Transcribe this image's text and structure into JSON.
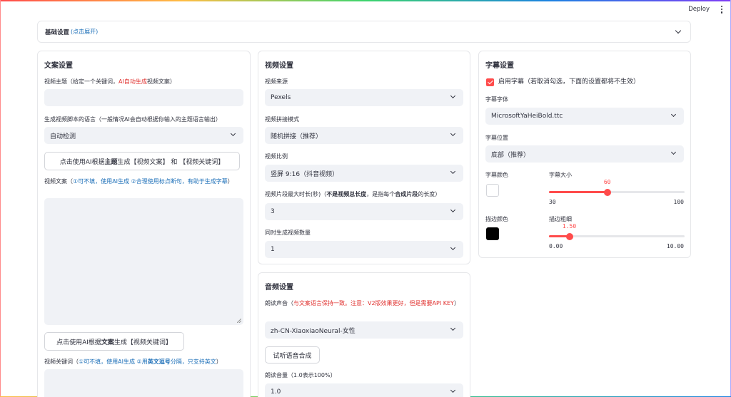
{
  "topbar": {
    "deploy": "Deploy"
  },
  "basic": {
    "title": "基础设置",
    "hint": "(点击展开)"
  },
  "script": {
    "title": "文案设置",
    "subject_label_a": "视频主题（给定一个关键词，",
    "subject_label_red": "AI自动生成",
    "subject_label_b": "视频文案）",
    "lang_label": "生成视频脚本的语言（一般情况AI会自动根据你输入的主题语言输出）",
    "lang_value": "自动检测",
    "gen_btn_a": "点击使用AI根据",
    "gen_btn_b": "主题",
    "gen_btn_c": "生成【视频文案】 和 【视频关键词】",
    "script_label_a": "视频文案（",
    "script_label_b": "①可不填，使用AI生成 ②合理使用标点断句，有助于生成字幕",
    "script_label_c": "）",
    "kw_btn_a": "点击使用AI根据",
    "kw_btn_b": "文案",
    "kw_btn_c": "生成【视频关键词】",
    "kw_label_a": "视频关键词（",
    "kw_label_b": "①可不填，使用AI生成 ②用",
    "kw_label_c": "英文逗号",
    "kw_label_d": "分隔，只支持英文",
    "kw_label_e": "）"
  },
  "video": {
    "title": "视频设置",
    "source_label": "视频来源",
    "source_value": "Pexels",
    "concat_label": "视频拼接模式",
    "concat_value": "随机拼接（推荐）",
    "ratio_label": "视频比例",
    "ratio_value": "竖屏 9:16（抖音视频）",
    "clip_label_a": "视频片段最大时长(秒)（",
    "clip_label_b": "不是视频总长度",
    "clip_label_c": "，是指每个",
    "clip_label_d": "合成片段",
    "clip_label_e": "的长度）",
    "clip_value": "3",
    "count_label": "同时生成视频数量",
    "count_value": "1"
  },
  "audio": {
    "title": "音频设置",
    "voice_label_a": "朗读声音（",
    "voice_label_b": "与文案语言保持一致。注意：V2版效果更好，但是需要API KEY",
    "voice_label_c": "）",
    "voice_value": "zh-CN-XiaoxiaoNeural-女性",
    "test_btn": "试听语音合成",
    "volume_label": "朗读音量（1.0表示100%）",
    "volume_value": "1.0"
  },
  "subtitle": {
    "title": "字幕设置",
    "enable_label": "启用字幕（若取消勾选，下面的设置都将不生效）",
    "font_label": "字幕字体",
    "font_value": "MicrosoftYaHeiBold.ttc",
    "pos_label": "字幕位置",
    "pos_value": "底部（推荐）",
    "color_label": "字幕颜色",
    "size_label": "字幕大小",
    "size_value": "60",
    "size_min": "30",
    "size_max": "100",
    "size_fraction": 0.43,
    "stroke_color_label": "描边颜色",
    "stroke_width_label": "描边粗细",
    "stroke_value": "1.50",
    "stroke_min": "0.00",
    "stroke_max": "10.00",
    "stroke_fraction": 0.15
  },
  "colors": {
    "accent": "#ff4b4b",
    "field_bg": "#f0f2f6",
    "subtitle_color": "#ffffff",
    "stroke_color": "#000000"
  }
}
